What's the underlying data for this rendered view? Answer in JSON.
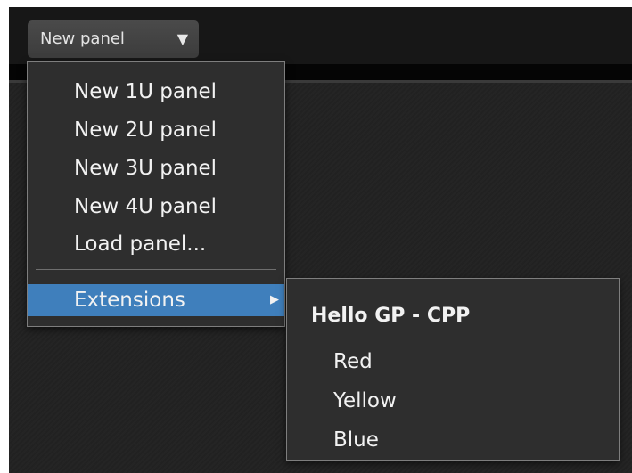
{
  "toolbar": {
    "dropdown_label": "New panel",
    "caret_icon": "caret-down-icon"
  },
  "menu": {
    "items": [
      {
        "label": "New 1U panel"
      },
      {
        "label": "New 2U panel"
      },
      {
        "label": "New 3U panel"
      },
      {
        "label": "New 4U panel"
      },
      {
        "label": "Load panel..."
      }
    ],
    "extensions": {
      "label": "Extensions",
      "arrow_icon": "submenu-arrow-icon"
    }
  },
  "submenu": {
    "header": "Hello GP - CPP",
    "items": [
      {
        "label": "Red"
      },
      {
        "label": "Yellow"
      },
      {
        "label": "Blue"
      }
    ]
  },
  "colors": {
    "highlight": "#3f7fbc",
    "menu_background": "#2e2e2e",
    "menu_border": "#7e7e7e",
    "text": "#f2f2f2"
  }
}
